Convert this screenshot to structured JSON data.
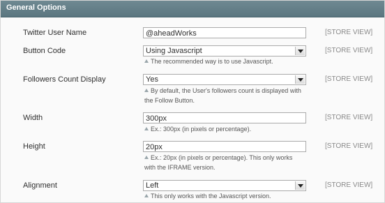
{
  "section": {
    "title": "General Options"
  },
  "rows": [
    {
      "label": "Twitter User Name",
      "value": "@aheadWorks",
      "scope": "[STORE VIEW]"
    },
    {
      "label": "Button Code",
      "value": "Using Javascript",
      "scope": "[STORE VIEW]",
      "note": "The recommended way is to use Javascript."
    },
    {
      "label": "Followers Count Display",
      "value": "Yes",
      "scope": "[STORE VIEW]",
      "note_line1": "By default, the User's followers count is displayed with",
      "note_line2": "the Follow Button."
    },
    {
      "label": "Width",
      "value": "300px",
      "scope": "[STORE VIEW]",
      "note": "Ex.: 300px (in pixels or percentage)."
    },
    {
      "label": "Height",
      "value": "20px",
      "scope": "[STORE VIEW]",
      "note_line1": "Ex.: 20px (in pixels or percentage). This only works",
      "note_line2": "with the IFRAME version."
    },
    {
      "label": "Alignment",
      "value": "Left",
      "scope": "[STORE VIEW]",
      "note": "This only works with the Javascript version."
    }
  ]
}
